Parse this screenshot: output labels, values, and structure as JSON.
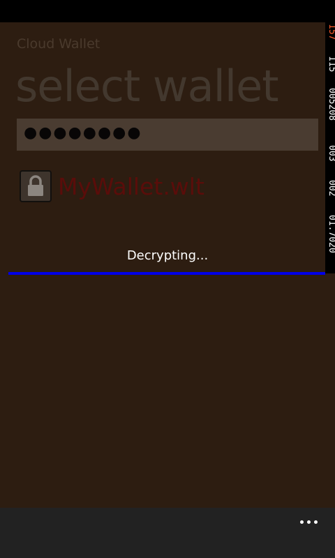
{
  "app": {
    "title": "Cloud Wallet",
    "page_title": "select wallet"
  },
  "password": {
    "masked_value": "●●●●●●●●"
  },
  "wallets": [
    {
      "name": "MyWallet.wlt",
      "icon": "lock-icon"
    }
  ],
  "progress": {
    "label": "Decrypting...",
    "fraction": 1.0,
    "color": "#0000e8"
  },
  "app_bar": {
    "more_icon": "ellipsis-icon"
  },
  "perf_counters": [
    "157",
    "115",
    "005208",
    "003",
    "002",
    "01.7020"
  ]
}
